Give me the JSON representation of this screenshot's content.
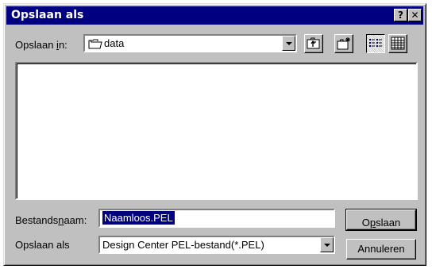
{
  "window": {
    "title": "Opslaan als",
    "help_label": "?",
    "close_label": "✕"
  },
  "toolbar": {
    "save_in_label_pre": "Opslaan ",
    "save_in_label_u": "i",
    "save_in_label_post": "n:",
    "folder_value": "data",
    "icons": [
      "up-folder-icon",
      "new-folder-icon",
      "list-view-icon",
      "details-view-icon"
    ]
  },
  "form": {
    "filename_label_pre": "Bestands",
    "filename_label_u": "n",
    "filename_label_post": "aam:",
    "filename_value": "Naamloos.PEL",
    "savetype_label": "Opslaan als",
    "savetype_value": "Design Center PEL-bestand(*.PEL)"
  },
  "buttons": {
    "save_pre": "O",
    "save_u": "p",
    "save_post": "slaan",
    "cancel": "Annuleren"
  }
}
